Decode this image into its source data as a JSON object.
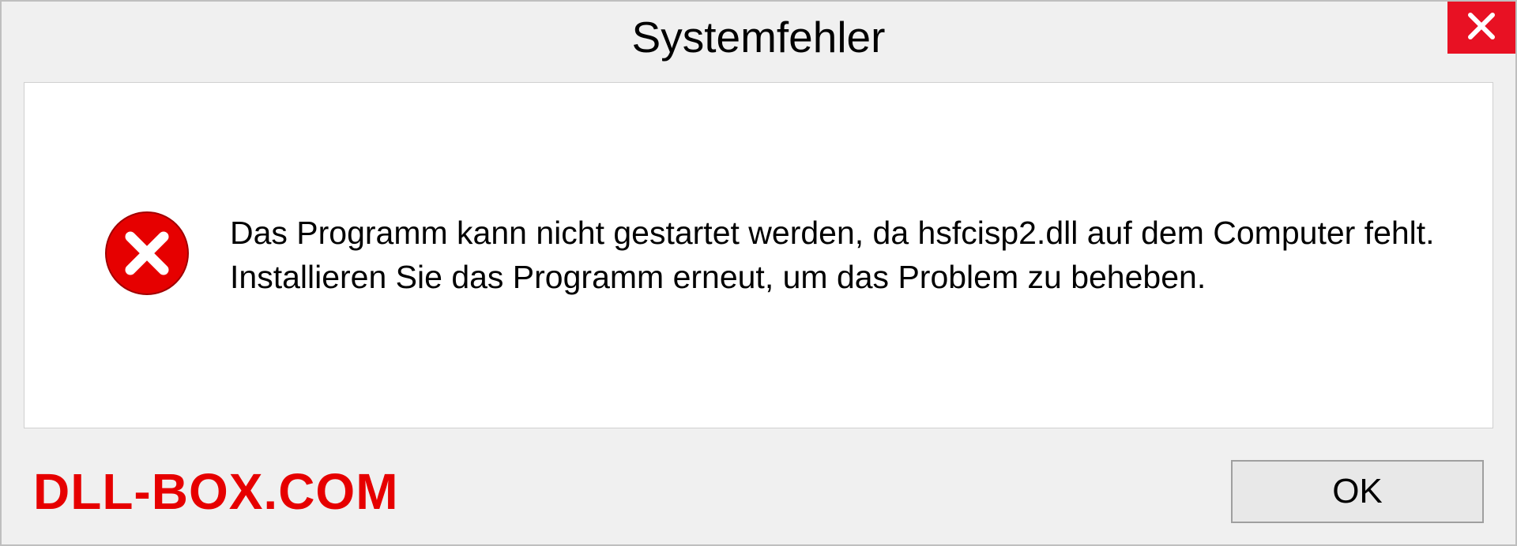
{
  "dialog": {
    "title": "Systemfehler",
    "message": "Das Programm kann nicht gestartet werden, da hsfcisp2.dll auf dem Computer fehlt. Installieren Sie das Programm erneut, um das Problem zu beheben.",
    "ok_label": "OK"
  },
  "watermark": "DLL-BOX.COM",
  "colors": {
    "close_bg": "#e81123",
    "error_icon": "#e60000",
    "watermark": "#e60000"
  }
}
